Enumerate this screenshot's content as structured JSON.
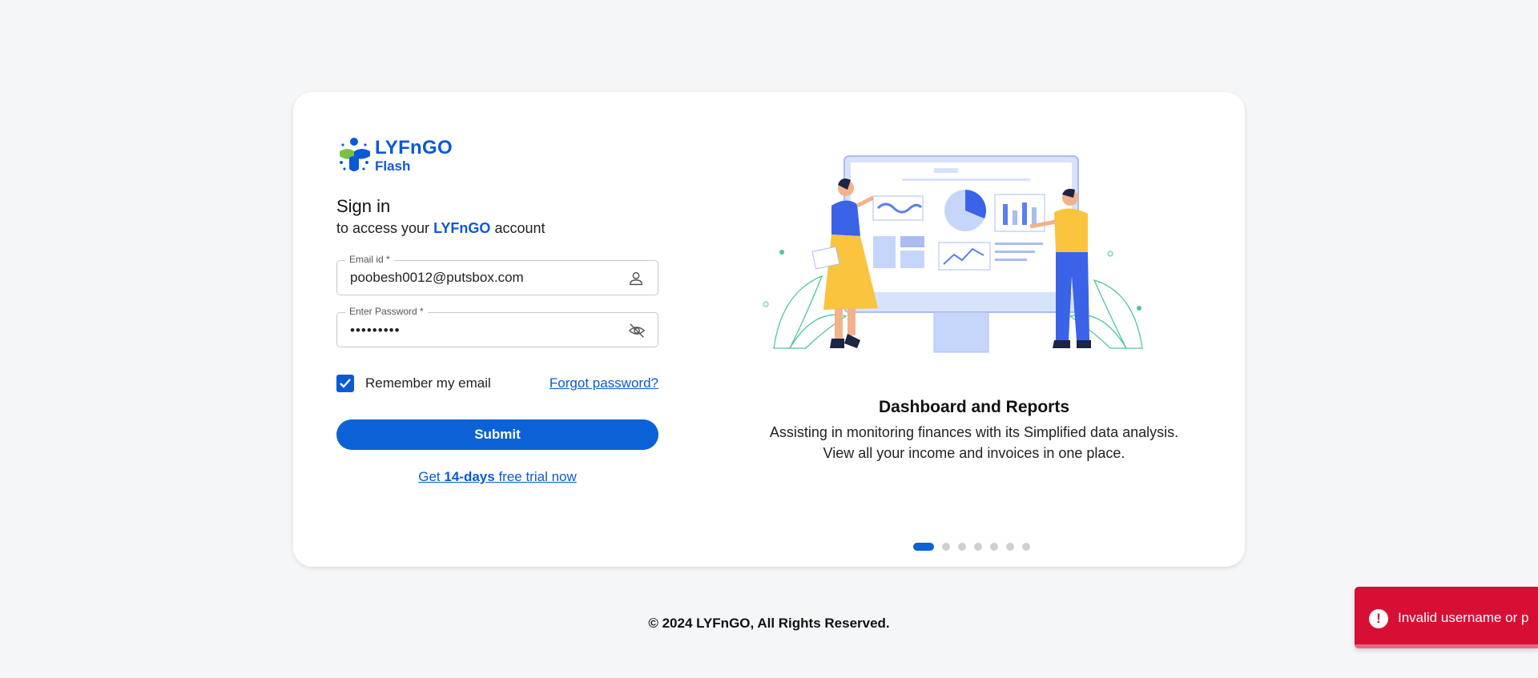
{
  "logo": {
    "brand": "LYFnGO",
    "sub": "Flash",
    "icon": "lyfngo-logo-icon"
  },
  "signin": {
    "title": "Sign in",
    "subtitle_prefix": "to access your",
    "subtitle_brand": "LYFnGO",
    "subtitle_suffix": "account"
  },
  "email": {
    "label": "Email id *",
    "value": "poobesh0012@putsbox.com",
    "icon": "user-icon"
  },
  "password": {
    "label": "Enter Password *",
    "value": "•••••••••",
    "icon": "eye-off-icon"
  },
  "remember": {
    "label": "Remember my email",
    "checked": true
  },
  "forgot_label": "Forgot password?",
  "submit_label": "Submit",
  "trial": {
    "prefix": "Get",
    "bold": "14-days",
    "suffix": "free trial now"
  },
  "feature": {
    "title": "Dashboard and Reports",
    "line1": "Assisting in monitoring finances with its Simplified data analysis.",
    "line2": "View all your income and invoices in one place."
  },
  "carousel": {
    "count": 7,
    "active_index": 0
  },
  "footer": "© 2024 LYFnGO, All Rights Reserved.",
  "toast": {
    "text": "Invalid username or p",
    "icon": "alert-icon",
    "color": "#d80f35"
  },
  "colors": {
    "accent": "#0a62d6",
    "background": "#f5f6f8"
  }
}
